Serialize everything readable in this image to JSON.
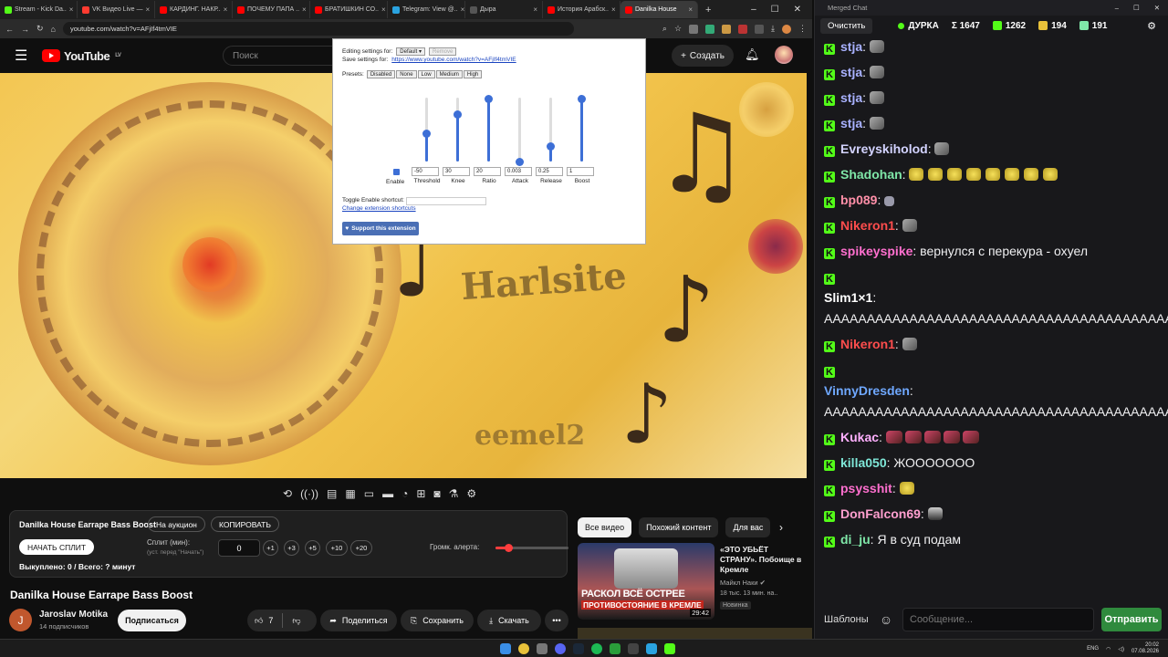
{
  "browser": {
    "tabs": [
      {
        "label": "Stream - Kick Da..",
        "color": "#53fc18"
      },
      {
        "label": "VK Видео Live —",
        "color": "#ff3b30"
      },
      {
        "label": "КАРДИНГ. НАКР..",
        "color": "#ff0000"
      },
      {
        "label": "ПОЧЕМУ ПАПА ..",
        "color": "#ff0000"
      },
      {
        "label": "БРАТИШКИН СО..",
        "color": "#ff0000"
      },
      {
        "label": "Telegram: View @..",
        "color": "#2aa3e0"
      },
      {
        "label": "Дыра",
        "color": "#555555"
      },
      {
        "label": "История Арабск..",
        "color": "#ff0000"
      },
      {
        "label": "Danilka House",
        "color": "#ff0000"
      }
    ],
    "new_tab": "+",
    "url": "youtube.com/watch?v=AFjIf4tmVIE"
  },
  "youtube": {
    "logo_text": "YouTube",
    "logo_region": "LV",
    "search_placeholder": "Поиск",
    "create_label": "Создать"
  },
  "compressor": {
    "editing_label": "Editing settings for:",
    "editing_value": "Default",
    "remove_label": "Remove",
    "save_label": "Save settings for:",
    "save_link": "https://www.youtube.com/watch?v=AFjIf4tmVIE",
    "presets_label": "Presets:",
    "presets": [
      "Disabled",
      "None",
      "Low",
      "Medium",
      "High"
    ],
    "enable_label": "Enable",
    "sliders": [
      {
        "label": "Threshold",
        "value": "-50",
        "level": 0.45
      },
      {
        "label": "Knee",
        "value": "30",
        "level": 0.75
      },
      {
        "label": "Ratio",
        "value": "20",
        "level": 1.0
      },
      {
        "label": "Attack",
        "value": "0.003",
        "level": 0.02
      },
      {
        "label": "Release",
        "value": "0.25",
        "level": 0.25
      },
      {
        "label": "Boost",
        "value": "1",
        "level": 1.0
      }
    ],
    "shortcut_label": "Toggle Enable shortcut:",
    "change_shortcuts": "Change extension shortcuts",
    "support_label": "Support this extension"
  },
  "video": {
    "overlay_text_1": "Harlsite",
    "overlay_text_2": "eemel2"
  },
  "split": {
    "title": "Danilka House Earrape Bass Boost",
    "auction_label": "На аукцион",
    "copy_label": "КОПИРОВАТЬ",
    "start_label": "НАЧАТЬ СПЛИТ",
    "split_label": "Сплит (мин):",
    "split_hint": "(уст. перед \"Начать\")",
    "split_value": "0",
    "increments": [
      "+1",
      "+3",
      "+5",
      "+10",
      "+20"
    ],
    "volume_label": "Громк. алерта:",
    "volume_level": 0.18,
    "bought_label": "Выкуплено: 0 / Всего: ? минут"
  },
  "watch": {
    "title": "Danilka House Earrape Bass Boost",
    "channel_initial": "J",
    "channel_name": "Jaroslav Motika",
    "subscribers": "14 подписчиков",
    "subscribe_label": "Подписаться",
    "likes": "7",
    "share_label": "Поделиться",
    "save_label": "Сохранить",
    "download_label": "Скачать",
    "more_label": "•••"
  },
  "related": {
    "tabs": [
      "Все видео",
      "Похожий контент",
      "Для вас"
    ],
    "video": {
      "thumb_line1": "РАСКОЛ ВСЁ ОСТРЕЕ",
      "thumb_line2": "ПРОТИВОСТОЯНИЕ В КРЕМЛЕ",
      "duration": "29:42",
      "title": "«ЭТО УБЬЁТ СТРАНУ». Побоище в Кремле",
      "author": "Майкл Наки",
      "meta": "18 тыс.   13 мин. на..",
      "badge": "Новинка"
    }
  },
  "chat": {
    "window_title": "Merged Chat",
    "clear_label": "Очистить",
    "streamer": "ДУРКА",
    "stats": [
      {
        "icon": "sum",
        "value": "Σ 1647"
      },
      {
        "icon": "kick-icon",
        "value": "1262"
      },
      {
        "icon": "vk-icon",
        "value": "194"
      },
      {
        "icon": "twitch-icon",
        "value": "191"
      }
    ],
    "messages": [
      {
        "user": "stja",
        "color": "#a9b2ff",
        "text": "",
        "emote": "rock",
        "count": 1
      },
      {
        "user": "stja",
        "color": "#a9b2ff",
        "text": "",
        "emote": "rock",
        "count": 1
      },
      {
        "user": "stja",
        "color": "#a9b2ff",
        "text": "",
        "emote": "rock",
        "count": 1
      },
      {
        "user": "stja",
        "color": "#a9b2ff",
        "text": "",
        "emote": "rock",
        "count": 1
      },
      {
        "user": "Evreyskiholod",
        "color": "#d3d3ff",
        "text": "",
        "emote": "rock",
        "count": 1
      },
      {
        "user": "Shadohan",
        "color": "#7fe7a8",
        "text": "",
        "emote": "yellow",
        "count": 8
      },
      {
        "user": "bp089",
        "color": "#ff8fa8",
        "text": "",
        "emote": "small",
        "count": 1
      },
      {
        "user": "Nikeron1",
        "color": "#ff4d4d",
        "text": "",
        "emote": "rock",
        "count": 1
      },
      {
        "user": "spikeyspike",
        "color": "#ff6fcf",
        "text": "вернулся с перекура - охуел",
        "emote": "",
        "count": 0
      },
      {
        "user": "Slim1×1",
        "color": "#ffffff",
        "text": "AAAAAAAAAAAAAAAAAAAAAAAAAAAAAAAAAAAAAAAAAAAAAAAAAAAAAAAAAAAAAAAAAAAAAAAAAAAAAAAAAAAAAAAAAAAAAAA",
        "emote": "",
        "count": 0,
        "block": true
      },
      {
        "user": "Nikeron1",
        "color": "#ff4d4d",
        "text": "",
        "emote": "rock",
        "count": 1
      },
      {
        "user": "VinnyDresden",
        "color": "#6fa8ff",
        "text": "AAAAAAAAAAAAAAAAAAAAAAAAAAAAAAAAAAAAAAAAAAAAAAAAAAAAAAAAAAAAAAAAAAAAAAAAAAAAAAAAAA",
        "emote": "",
        "count": 0,
        "block": true
      },
      {
        "user": "Kukac",
        "color": "#ffb0ff",
        "text": "",
        "emote": "brown",
        "count": 5
      },
      {
        "user": "killa050",
        "color": "#7fe7d8",
        "text": "ЖООООООО",
        "emote": "",
        "count": 0
      },
      {
        "user": "psysshit",
        "color": "#ff6fcf",
        "text": "",
        "emote": "yellow",
        "count": 1
      },
      {
        "user": "DonFalcon69",
        "color": "#ff9fcf",
        "text": "",
        "emote": "face",
        "count": 1
      },
      {
        "user": "di_ju",
        "color": "#7fe7a8",
        "text": "Я в суд подам",
        "emote": "",
        "count": 0
      }
    ],
    "templates_label": "Шаблоны",
    "emoji_label": "☺",
    "input_placeholder": "Сообщение...",
    "send_label": "Отправить"
  },
  "taskbar": {
    "lang": "ENG",
    "time": "20:02",
    "date": "07.08.2026"
  }
}
